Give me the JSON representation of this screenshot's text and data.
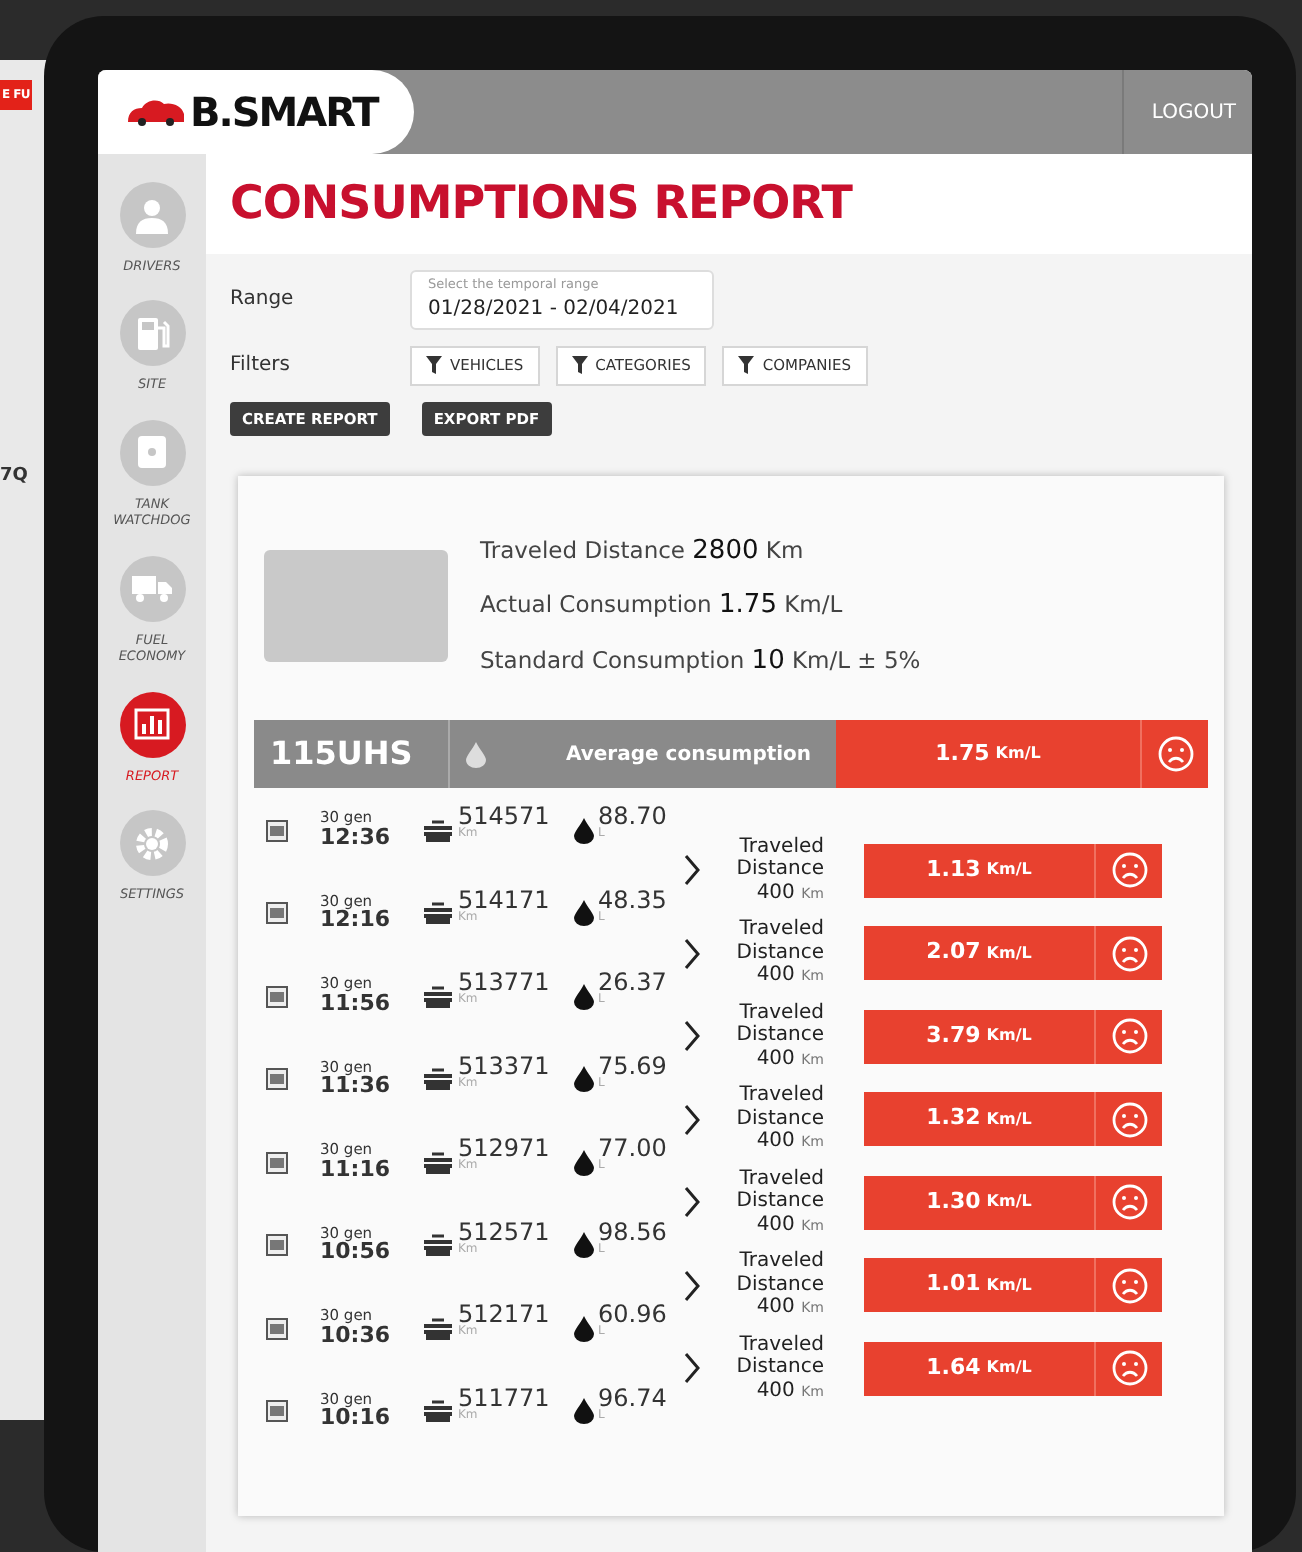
{
  "background": {
    "badge": "E FU",
    "code": "7Q"
  },
  "header": {
    "logo_text": "B.SMART",
    "logout": "LOGOUT"
  },
  "sidebar": {
    "items": [
      {
        "label": "DRIVERS",
        "kind": "person",
        "selected": false
      },
      {
        "label": "SITE",
        "kind": "pump",
        "selected": false
      },
      {
        "label": "TANK WATCHDOG",
        "kind": "tank",
        "selected": false
      },
      {
        "label": "FUEL ECONOMY",
        "kind": "truck",
        "selected": false
      },
      {
        "label": "REPORT",
        "kind": "chart",
        "selected": true
      },
      {
        "label": "SETTINGS",
        "kind": "gear",
        "selected": false
      }
    ]
  },
  "page": {
    "title": "CONSUMPTIONS REPORT",
    "range_label": "Range",
    "range_field": {
      "placeholder": "Select the temporal range",
      "value": "01/28/2021 - 02/04/2021"
    },
    "filters_label": "Filters",
    "filters": [
      "VEHICLES",
      "CATEGORIES",
      "COMPANIES"
    ],
    "actions": [
      "CREATE REPORT",
      "EXPORT PDF"
    ]
  },
  "summary": {
    "lines": [
      {
        "label": "Traveled Distance",
        "value": "2800",
        "unit": "Km"
      },
      {
        "label": "Actual Consumption",
        "value": "1.75",
        "unit": "Km/L"
      },
      {
        "label": "Standard Consumption",
        "value": "10",
        "unit": "Km/L ± 5%"
      }
    ]
  },
  "vehicle_bar": {
    "plate": "115UHS",
    "label": "Average consumption",
    "value": "1.75",
    "unit": "Km/L"
  },
  "entries": [
    {
      "date": "30 gen",
      "time": "12:36",
      "odometer": "514571",
      "odometer_unit": "Km",
      "fuel": "88.70",
      "fuel_unit": "L"
    },
    {
      "date": "30 gen",
      "time": "12:16",
      "odometer": "514171",
      "odometer_unit": "Km",
      "fuel": "48.35",
      "fuel_unit": "L"
    },
    {
      "date": "30 gen",
      "time": "11:56",
      "odometer": "513771",
      "odometer_unit": "Km",
      "fuel": "26.37",
      "fuel_unit": "L"
    },
    {
      "date": "30 gen",
      "time": "11:36",
      "odometer": "513371",
      "odometer_unit": "Km",
      "fuel": "75.69",
      "fuel_unit": "L"
    },
    {
      "date": "30 gen",
      "time": "11:16",
      "odometer": "512971",
      "odometer_unit": "Km",
      "fuel": "77.00",
      "fuel_unit": "L"
    },
    {
      "date": "30 gen",
      "time": "10:56",
      "odometer": "512571",
      "odometer_unit": "Km",
      "fuel": "98.56",
      "fuel_unit": "L"
    },
    {
      "date": "30 gen",
      "time": "10:36",
      "odometer": "512171",
      "odometer_unit": "Km",
      "fuel": "60.96",
      "fuel_unit": "L"
    },
    {
      "date": "30 gen",
      "time": "10:16",
      "odometer": "511771",
      "odometer_unit": "Km",
      "fuel": "96.74",
      "fuel_unit": "L"
    }
  ],
  "segments": [
    {
      "label": "Traveled Distance",
      "distance": "400",
      "unit": "Km",
      "value": "1.13",
      "value_unit": "Km/L"
    },
    {
      "label": "Traveled Distance",
      "distance": "400",
      "unit": "Km",
      "value": "2.07",
      "value_unit": "Km/L"
    },
    {
      "label": "Traveled Distance",
      "distance": "400",
      "unit": "Km",
      "value": "3.79",
      "value_unit": "Km/L"
    },
    {
      "label": "Traveled Distance",
      "distance": "400",
      "unit": "Km",
      "value": "1.32",
      "value_unit": "Km/L"
    },
    {
      "label": "Traveled Distance",
      "distance": "400",
      "unit": "Km",
      "value": "1.30",
      "value_unit": "Km/L"
    },
    {
      "label": "Traveled Distance",
      "distance": "400",
      "unit": "Km",
      "value": "1.01",
      "value_unit": "Km/L"
    },
    {
      "label": "Traveled Distance",
      "distance": "400",
      "unit": "Km",
      "value": "1.64",
      "value_unit": "Km/L"
    }
  ]
}
